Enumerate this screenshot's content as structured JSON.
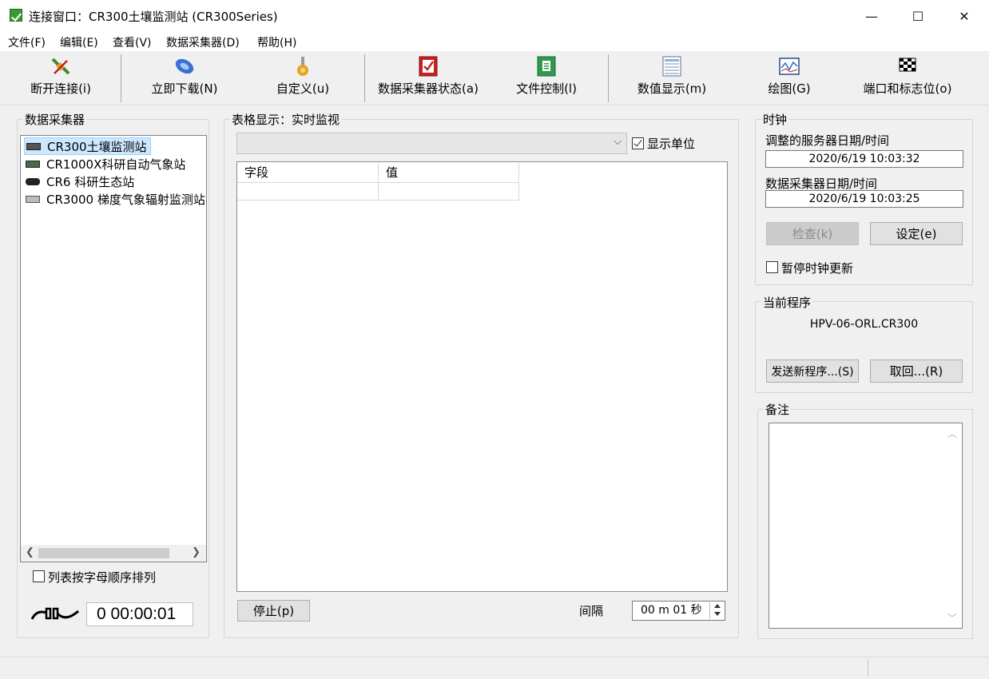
{
  "window": {
    "title": "连接窗口：CR300土壤监测站 (CR300Series)",
    "controls": [
      "—",
      "☐",
      "✕"
    ]
  },
  "menu": [
    "文件(F)",
    "编辑(E)",
    "查看(V)",
    "数据采集器(D)",
    "帮助(H)"
  ],
  "toolbar": [
    {
      "label": "断开连接(i)",
      "icon": "disconnect-plug-icon"
    },
    {
      "label": "立即下载(N)",
      "icon": "download-phone-icon"
    },
    {
      "label": "自定义(u)",
      "icon": "custom-wrench-icon"
    },
    {
      "label": "数据采集器状态(a)",
      "icon": "status-check-icon"
    },
    {
      "label": "文件控制(l)",
      "icon": "file-control-icon"
    },
    {
      "label": "数值显示(m)",
      "icon": "numeric-display-icon"
    },
    {
      "label": "绘图(G)",
      "icon": "graph-icon"
    },
    {
      "label": "端口和标志位(o)",
      "icon": "checkered-flag-icon"
    }
  ],
  "datalogger_panel": {
    "title": "数据采集器",
    "items": [
      {
        "label": "CR300土壤监测站",
        "selected": true
      },
      {
        "label": "CR1000X科研自动气象站",
        "selected": false
      },
      {
        "label": "CR6 科研生态站",
        "selected": false
      },
      {
        "label": "CR3000 梯度气象辐射监测站",
        "selected": false
      }
    ],
    "sort_label": "列表按字母顺序排列",
    "sort_checked": false,
    "connection_timer": "0 00:00:01"
  },
  "table_panel": {
    "title": "表格显示：实时监视",
    "table_select_value": "",
    "show_units_label": "显示单位",
    "show_units_checked": true,
    "columns": [
      "字段",
      "值"
    ],
    "rows": [
      [
        "",
        ""
      ]
    ],
    "stop_label": "停止(p)",
    "interval_label": "间隔",
    "interval_value": "00 m 01 秒"
  },
  "clock_panel": {
    "title": "时钟",
    "server_label": "调整的服务器日期/时间",
    "server_time": "2020/6/19 10:03:32",
    "logger_label": "数据采集器日期/时间",
    "logger_time": "2020/6/19 10:03:25",
    "check_label": "检查(k)",
    "set_label": "设定(e)",
    "pause_label": "暂停时钟更新",
    "pause_checked": false
  },
  "program_panel": {
    "title": "当前程序",
    "program_name": "HPV-06-ORL.CR300",
    "send_label": "发送新程序...(S)",
    "retrieve_label": "取回...(R)"
  },
  "notes_panel": {
    "title": "备注",
    "text": ""
  }
}
